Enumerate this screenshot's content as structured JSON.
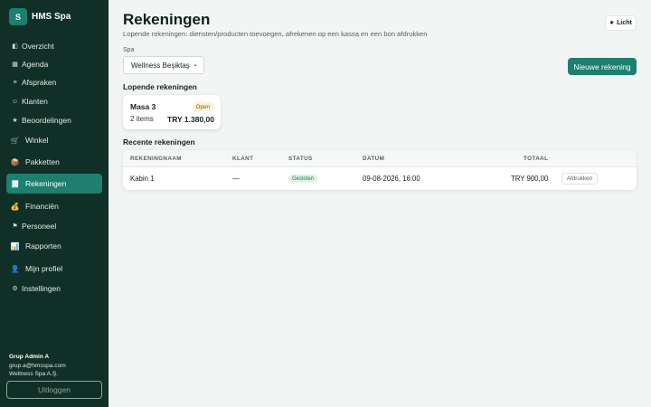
{
  "brand": {
    "logo_letter": "S",
    "name": "HMS Spa"
  },
  "nav": [
    {
      "label": "Overzicht",
      "icon": "◧"
    },
    {
      "label": "Agenda",
      "icon": "▦"
    },
    {
      "label": "Afspraken",
      "icon": "≡"
    },
    {
      "label": "Klanten",
      "icon": "☺"
    },
    {
      "label": "Beoordelingen",
      "icon": "★"
    },
    {
      "label": "Winkel",
      "icon": "🛒"
    },
    {
      "label": "Pakketten",
      "icon": "📦"
    },
    {
      "label": "Rekeningen",
      "icon": "🧾"
    },
    {
      "label": "Financiën",
      "icon": "💰"
    },
    {
      "label": "Personeel",
      "icon": "⚑"
    },
    {
      "label": "Rapporten",
      "icon": "📊"
    },
    {
      "label": "Mijn profiel",
      "icon": "👤"
    },
    {
      "label": "Instellingen",
      "icon": "⚙"
    }
  ],
  "user": {
    "name": "Grup Admin A",
    "email": "grup.a@hmsspa.com",
    "company": "Wellness Spa A.Ş."
  },
  "logout_label": "Uitloggen",
  "header": {
    "title": "Rekeningen",
    "subtitle": "Lopende rekeningen: diensten/producten toevoegen, afrekenen op een kassa en een bon afdrukken",
    "theme_label": "Licht"
  },
  "spa_select": {
    "label": "Spa",
    "value": "Wellness Beşiktaş"
  },
  "new_button_label": "Nieuwe rekening",
  "open_section": {
    "heading": "Lopende rekeningen",
    "card": {
      "name": "Masa 3",
      "status": "Open",
      "items": "2 items",
      "total": "TRY 1.380,00"
    }
  },
  "recent_section": {
    "heading": "Recente rekeningen",
    "columns": {
      "name": "REKENINGNAAM",
      "client": "KLANT",
      "status": "STATUS",
      "date": "DATUM",
      "total": "TOTAAL"
    },
    "rows": [
      {
        "name": "Kabin 1",
        "client": "—",
        "status": "Gesloten",
        "date": "09-08-2026, 16:00",
        "total": "TRY 900,00",
        "action": "Afdrukken"
      }
    ]
  },
  "colors": {
    "sidebar": "#0f2f27",
    "accent": "#1d7f6e",
    "background": "#f2f5f3"
  }
}
